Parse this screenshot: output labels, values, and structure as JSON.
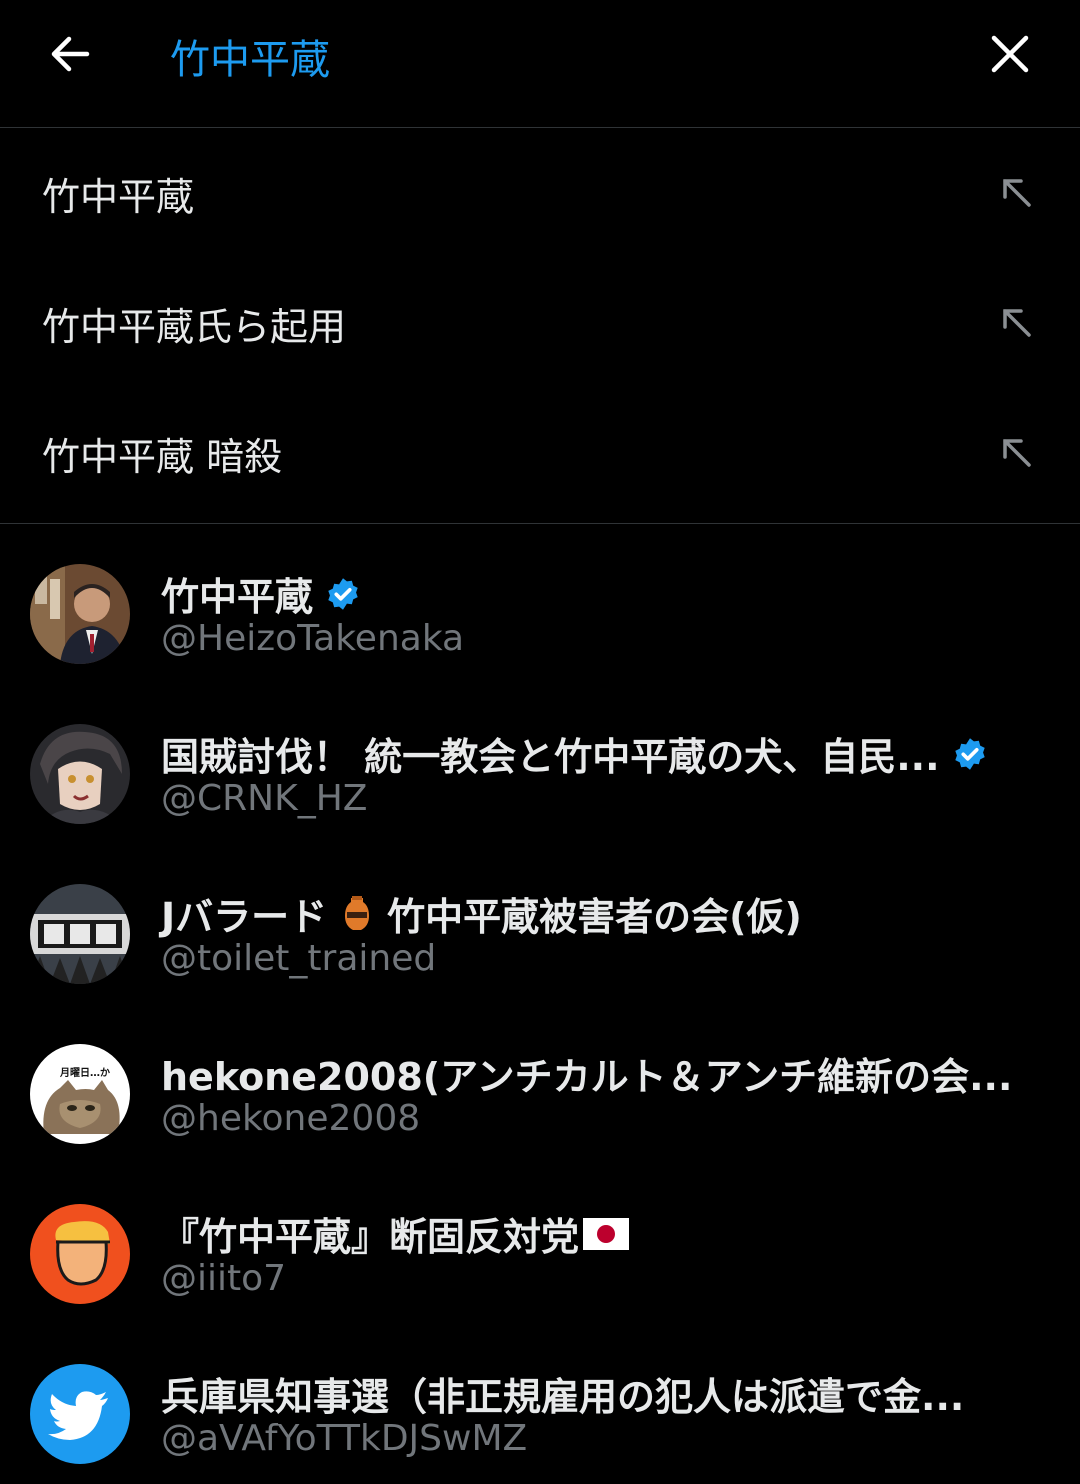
{
  "search": {
    "value": "竹中平蔵",
    "placeholder": ""
  },
  "header": {
    "back_icon": "arrow-left-icon",
    "close_icon": "close-icon"
  },
  "suggestions": [
    {
      "label": "竹中平蔵"
    },
    {
      "label": "竹中平蔵氏ら起用"
    },
    {
      "label": "竹中平蔵 暗殺"
    }
  ],
  "users": [
    {
      "name": "竹中平蔵",
      "handle": "@HeizoTakenaka",
      "verified": true
    },
    {
      "name": "国賊討伐！ 統一教会と竹中平蔵の犬、自民...",
      "handle": "@CRNK_HZ",
      "verified": true
    },
    {
      "name_prefix": "Jバラード",
      "name_suffix": "竹中平蔵被害者の会(仮)",
      "handle": "@toilet_trained",
      "verified": false
    },
    {
      "name": "hekone2008(アンチカルト＆アンチ維新の会...",
      "handle": "@hekone2008",
      "verified": false,
      "avatar_text": "月曜日…か"
    },
    {
      "name": "『竹中平蔵』断固反対党",
      "handle": "@iiito7",
      "verified": false
    },
    {
      "name": "兵庫県知事選（非正規雇用の犯人は派遣で金...",
      "handle": "@aVAfYoTTkDJSwMZ",
      "verified": false
    }
  ],
  "colors": {
    "accent": "#1d9bf0",
    "background": "#000000",
    "text": "#e7e9ea",
    "muted": "#71767b",
    "divider": "#2f3336"
  }
}
